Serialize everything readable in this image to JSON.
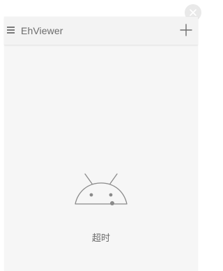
{
  "toolbar": {
    "title": "EhViewer",
    "menu_icon": "hamburger-menu-icon",
    "add_icon": "plus-icon"
  },
  "overlay": {
    "close_icon": "close-icon"
  },
  "empty_state": {
    "icon": "sad-android-icon",
    "message": "超时"
  },
  "colors": {
    "background": "#f6f6f6",
    "toolbar": "#f3f3f3",
    "icon": "#7a7a7a",
    "text": "#6a6a6a"
  }
}
